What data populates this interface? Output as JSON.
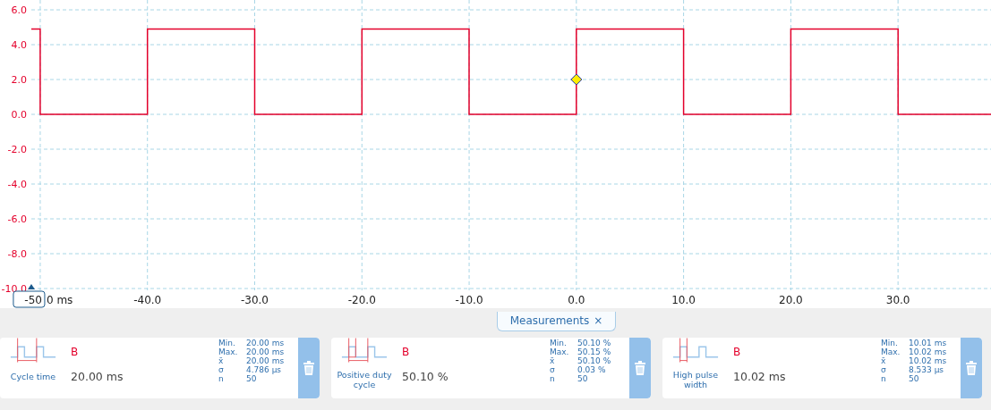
{
  "chart": {
    "offset_suffix": "0 ms",
    "chart_data": {
      "type": "line",
      "grid": true,
      "xlim": [
        -50.83,
        38.67
      ],
      "ylim": [
        -10,
        6
      ],
      "xticks": [
        {
          "value": -50,
          "label": "-50"
        },
        {
          "value": -40,
          "label": "-40.0"
        },
        {
          "value": -30,
          "label": "-30.0"
        },
        {
          "value": -20,
          "label": "-20.0"
        },
        {
          "value": -10,
          "label": "-10.0"
        },
        {
          "value": 0,
          "label": "0.0"
        },
        {
          "value": 10,
          "label": "10.0"
        },
        {
          "value": 20,
          "label": "20.0"
        },
        {
          "value": 30,
          "label": "30.0"
        }
      ],
      "yticks": [
        {
          "value": 6,
          "label": "6.0"
        },
        {
          "value": 4,
          "label": "4.0"
        },
        {
          "value": 2,
          "label": "2.0"
        },
        {
          "value": 0,
          "label": "0.0"
        },
        {
          "value": -2,
          "label": "-2.0"
        },
        {
          "value": -4,
          "label": "-4.0"
        },
        {
          "value": -6,
          "label": "-6.0"
        },
        {
          "value": -8,
          "label": "-8.0"
        },
        {
          "value": -10,
          "label": "-10.0"
        }
      ],
      "x": [
        -50.83,
        -50,
        -50,
        -40,
        -40,
        -30,
        -30,
        -20,
        -20,
        -10,
        -10,
        0,
        0,
        10,
        10,
        20,
        20,
        30,
        30,
        38.67
      ],
      "series": [
        {
          "color": "#e4002b",
          "values": [
            4.9,
            4.9,
            0,
            0,
            4.9,
            4.9,
            0,
            0,
            4.9,
            4.9,
            0,
            0,
            4.9,
            4.9,
            0,
            0,
            4.9,
            4.9,
            0,
            0
          ]
        }
      ]
    }
  },
  "measurements_tab": {
    "label": "Measurements",
    "close": "×"
  },
  "cards": [
    {
      "kind": "cycle",
      "name": "Cycle time",
      "channel": "B",
      "value": "20.00 ms",
      "stats": [
        {
          "label": "Min.",
          "value": "20.00 ms"
        },
        {
          "label": "Max.",
          "value": "20.00 ms"
        },
        {
          "label": "x̄",
          "value": "20.00 ms"
        },
        {
          "label": "σ",
          "value": "4.786 µs"
        },
        {
          "label": "n",
          "value": "50"
        }
      ]
    },
    {
      "kind": "duty",
      "name": "Positive duty cycle",
      "channel": "B",
      "value": "50.10 %",
      "stats": [
        {
          "label": "Min.",
          "value": "50.10 %"
        },
        {
          "label": "Max.",
          "value": "50.15 %"
        },
        {
          "label": "x̄",
          "value": "50.10 %"
        },
        {
          "label": "σ",
          "value": "0.03 %"
        },
        {
          "label": "n",
          "value": "50"
        }
      ]
    },
    {
      "kind": "high_pulse",
      "name": "High pulse width",
      "channel": "B",
      "value": "10.02 ms",
      "stats": [
        {
          "label": "Min.",
          "value": "10.01 ms"
        },
        {
          "label": "Max.",
          "value": "10.02 ms"
        },
        {
          "label": "x̄",
          "value": "10.02 ms"
        },
        {
          "label": "σ",
          "value": "8.533 µs"
        },
        {
          "label": "n",
          "value": "50"
        }
      ]
    }
  ]
}
